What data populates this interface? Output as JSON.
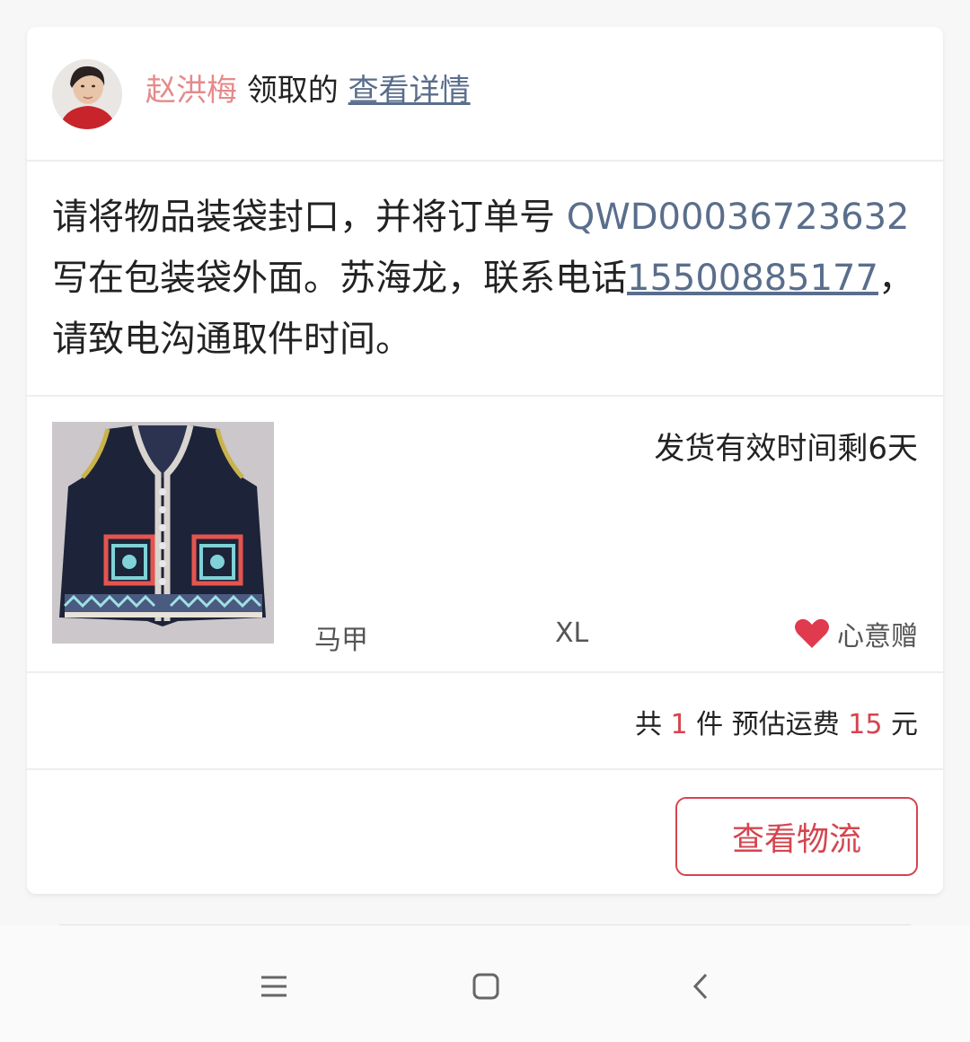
{
  "header": {
    "username": "赵洪梅",
    "action_text": "领取的",
    "details_link": "查看详情"
  },
  "instruction": {
    "part1": "请将物品装袋封口，并将订单号 ",
    "order_number": "QWD00036723632",
    "part2": " 写在包装袋外面。苏海龙，联系电话",
    "phone": "15500885177",
    "part3": "，请致电沟通取件时间。"
  },
  "product": {
    "deadline": "发货有效时间剩6天",
    "name": "马甲",
    "size": "XL",
    "gift_label": "心意赠"
  },
  "summary": {
    "prefix": "共",
    "count": "1",
    "count_unit": "件",
    "fee_label": "预估运费",
    "fee": "15",
    "fee_unit": "元"
  },
  "actions": {
    "logistics_button": "查看物流"
  },
  "navbar": {
    "icons": [
      "menu-icon",
      "home-icon",
      "back-icon"
    ]
  },
  "colors": {
    "username": "#e58a8a",
    "link": "#5a6e8c",
    "accent_red": "#d5454f"
  }
}
